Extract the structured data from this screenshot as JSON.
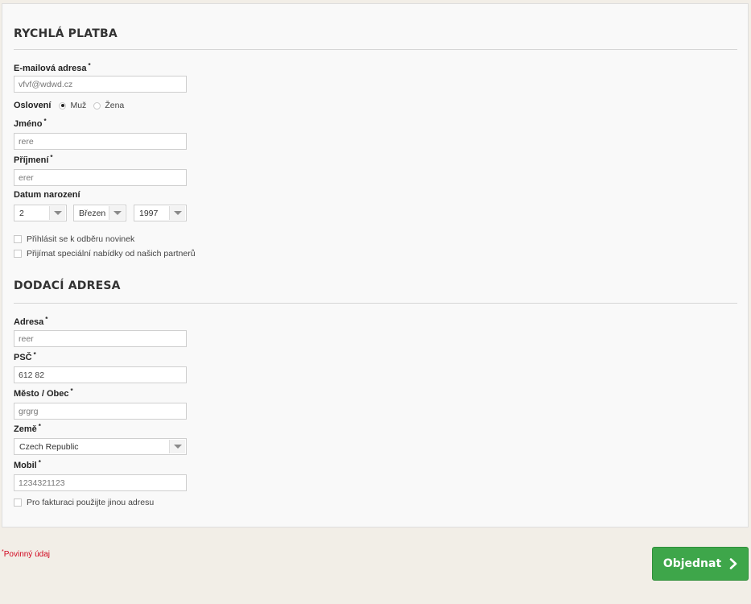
{
  "quick_payment": {
    "title": "RYCHLÁ PLATBA",
    "email": {
      "label": "E-mailová adresa",
      "value": "vfvf@wdwd.cz"
    },
    "salutation": {
      "label": "Oslovení",
      "options": [
        "Muž",
        "Žena"
      ],
      "selected": "Muž"
    },
    "first_name": {
      "label": "Jméno",
      "value": "rere"
    },
    "last_name": {
      "label": "Příjmení",
      "value": "erer"
    },
    "birth_date": {
      "label": "Datum narození",
      "day": "2",
      "month": "Březen",
      "year": "1997"
    },
    "newsletter_label": "Přihlásit se k odběru novinek",
    "partners_label": "Přijímat speciální nabídky od našich partnerů"
  },
  "delivery": {
    "title": "DODACÍ ADRESA",
    "address": {
      "label": "Adresa",
      "value": "reer"
    },
    "zip": {
      "label": "PSČ",
      "value": "612 82"
    },
    "city": {
      "label": "Město / Obec",
      "value": "grgrg"
    },
    "country": {
      "label": "Země",
      "value": "Czech Republic"
    },
    "mobile": {
      "label": "Mobil",
      "value": "1234321123"
    },
    "billing_label": "Pro fakturaci použijte jinou adresu"
  },
  "required_mark": "*",
  "required_note": "Povinný údaj",
  "submit_label": "Objednat",
  "colors": {
    "submit_bg": "#3ea64a",
    "required_text": "#d0021b"
  }
}
